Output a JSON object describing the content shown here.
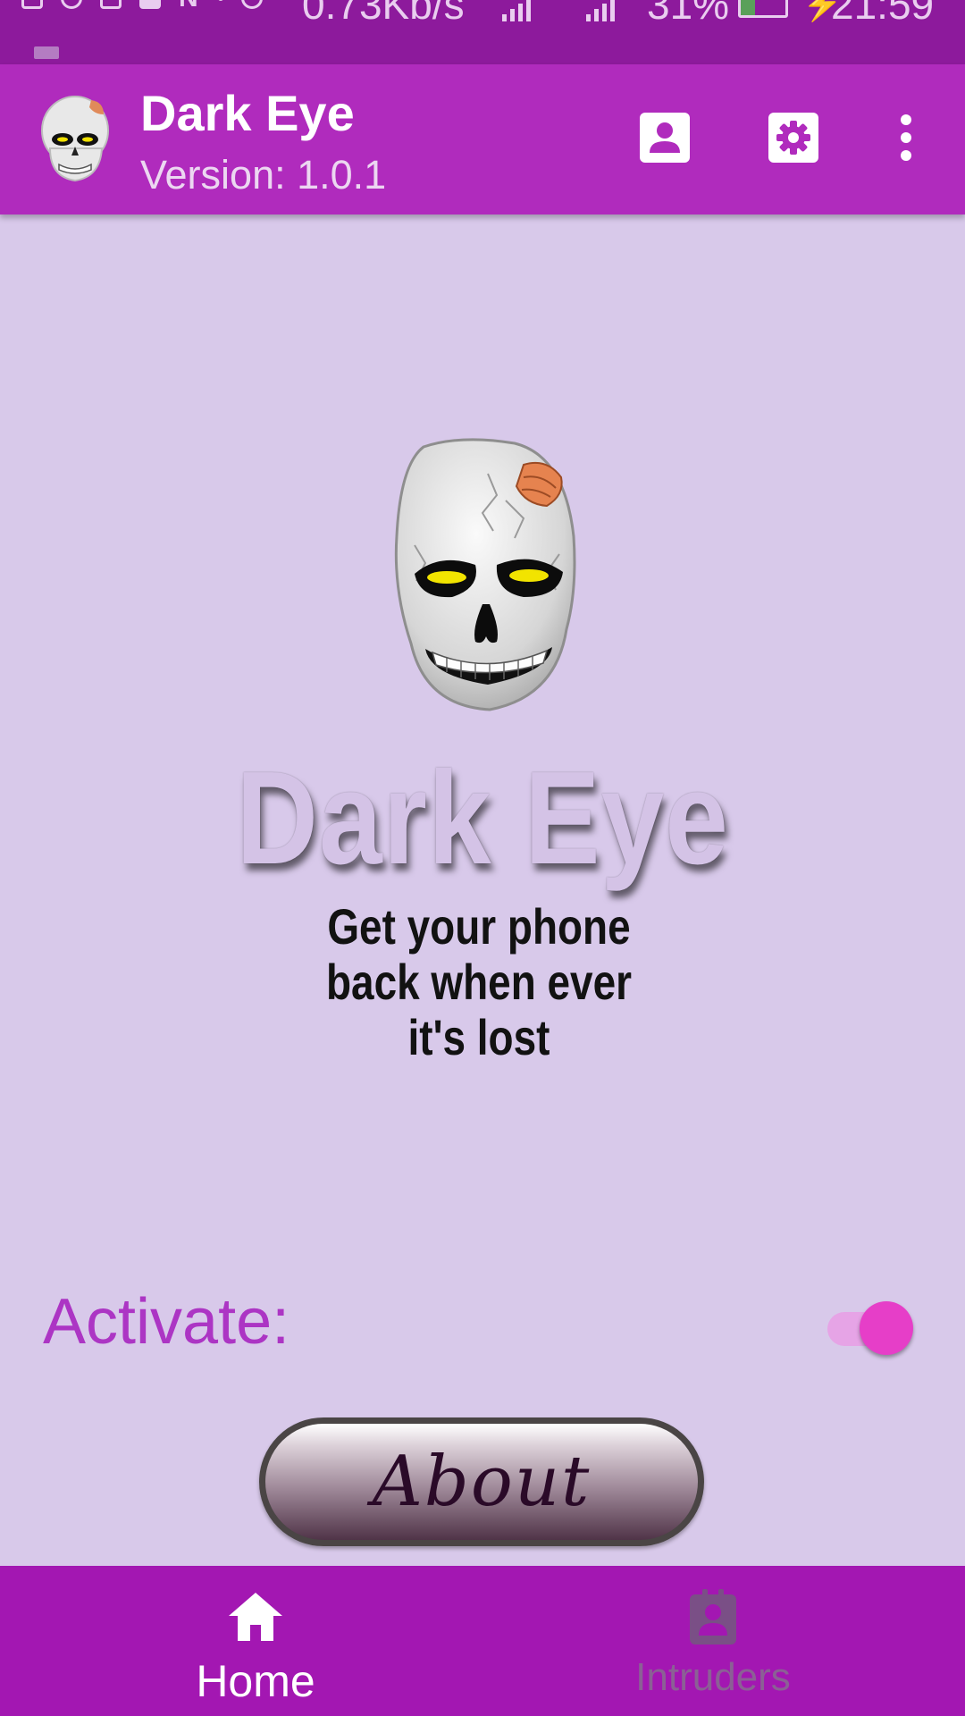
{
  "status_bar": {
    "speed": "0.73Kb/s",
    "battery_percent": "31%",
    "battery_level": 0.31,
    "time": "21:59"
  },
  "app_bar": {
    "title": "Dark Eye",
    "subtitle": "Version: 1.0.1",
    "actions": [
      "person-icon",
      "gear-icon",
      "more-vert-icon"
    ]
  },
  "main": {
    "hero_title": "Dark Eye",
    "tagline": "Get your phone back when ever it's lost",
    "activate_label": "Activate:",
    "activate_on": true,
    "about_label": "About"
  },
  "bottom_nav": {
    "items": [
      {
        "label": "Home",
        "icon": "home-icon",
        "active": true
      },
      {
        "label": "Intruders",
        "icon": "contact-badge-icon",
        "active": false
      }
    ]
  },
  "colors": {
    "app_bar": "#b02bbd",
    "status_bar": "#8d1a9c",
    "background": "#d8c9ea",
    "accent": "#e63ec8",
    "activate_text": "#ac35c4",
    "bottom_nav": "#a317b2"
  }
}
